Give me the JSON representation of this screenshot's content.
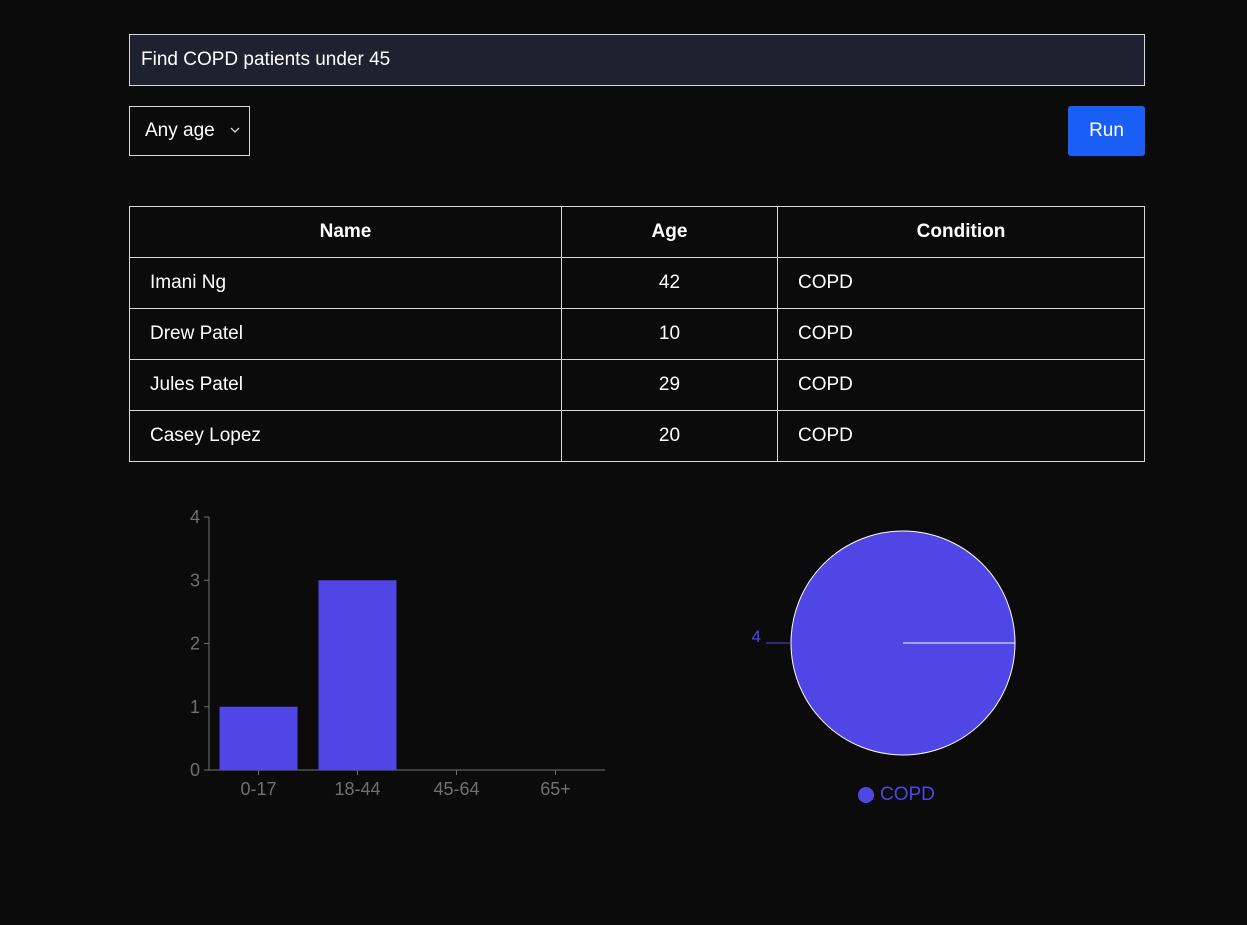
{
  "query": {
    "value": "Find COPD patients under 45",
    "placeholder": ""
  },
  "filters": {
    "age_selected": "Any age"
  },
  "actions": {
    "run_label": "Run"
  },
  "table": {
    "headers": [
      "Name",
      "Age",
      "Condition"
    ],
    "rows": [
      {
        "name": "Imani Ng",
        "age": "42",
        "condition": "COPD"
      },
      {
        "name": "Drew Patel",
        "age": "10",
        "condition": "COPD"
      },
      {
        "name": "Jules Patel",
        "age": "29",
        "condition": "COPD"
      },
      {
        "name": "Casey Lopez",
        "age": "20",
        "condition": "COPD"
      }
    ]
  },
  "colors": {
    "accent": "#1a5ff5",
    "series": "#4f46e5",
    "axis": "#707070",
    "input_bg": "#1e2230",
    "page_bg": "#0b0b0c"
  },
  "chart_data": [
    {
      "type": "bar",
      "categories": [
        "0-17",
        "18-44",
        "45-64",
        "65+"
      ],
      "values": [
        1,
        3,
        0,
        0
      ],
      "ylim": [
        0,
        4
      ],
      "yticks": [
        0,
        1,
        2,
        3,
        4
      ],
      "title": "",
      "xlabel": "",
      "ylabel": ""
    },
    {
      "type": "pie",
      "labels": [
        "COPD"
      ],
      "values": [
        4
      ],
      "legend": [
        "COPD"
      ],
      "legend_position": "bottom"
    }
  ]
}
